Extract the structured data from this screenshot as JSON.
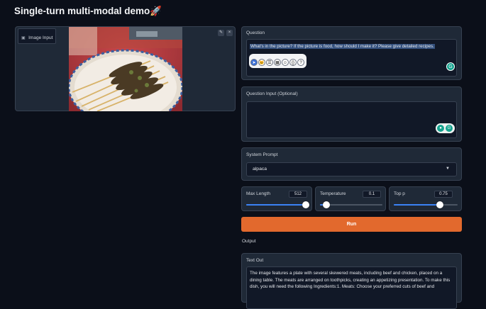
{
  "page": {
    "title": "Single-turn multi-modal demo",
    "title_emoji": "🚀"
  },
  "image_input": {
    "label": "Image Input",
    "edit_icon": "pencil-icon",
    "close_icon": "close-icon"
  },
  "question": {
    "label": "Question",
    "value": "What's in the picture? If the picture is food, how should I make it? Please give detailed recipes."
  },
  "toolbar_icons": [
    "cursor-icon",
    "cat-icon",
    "list-icon",
    "grid-icon",
    "smile-icon",
    "braces-icon",
    "help-icon"
  ],
  "question_input": {
    "label": "Question Input (Optional)",
    "value": ""
  },
  "system_prompt": {
    "label": "System Prompt",
    "value": "alpaca"
  },
  "sliders": {
    "max_length": {
      "label": "Max Length",
      "value": "512",
      "fraction": 0.96
    },
    "temperature": {
      "label": "Temperature",
      "value": "0.1",
      "fraction": 0.1
    },
    "top_p": {
      "label": "Top p",
      "value": "0.75",
      "fraction": 0.72
    }
  },
  "run_button": {
    "label": "Run"
  },
  "output": {
    "section_label": "Output",
    "text_label": "Text Out",
    "text": "The image features a plate with several skewered meats, including beef and chicken, placed on a dining table. The meats are arranged on toothpicks, creating an appetizing presentation. To make this dish, you will need the following Ingredients:1. Meats: Choose your preferred cuts of beef and"
  },
  "colors": {
    "background": "#0b0f19",
    "panel": "#1f2937",
    "accent": "#e2692d",
    "slider": "#3b82f6"
  }
}
